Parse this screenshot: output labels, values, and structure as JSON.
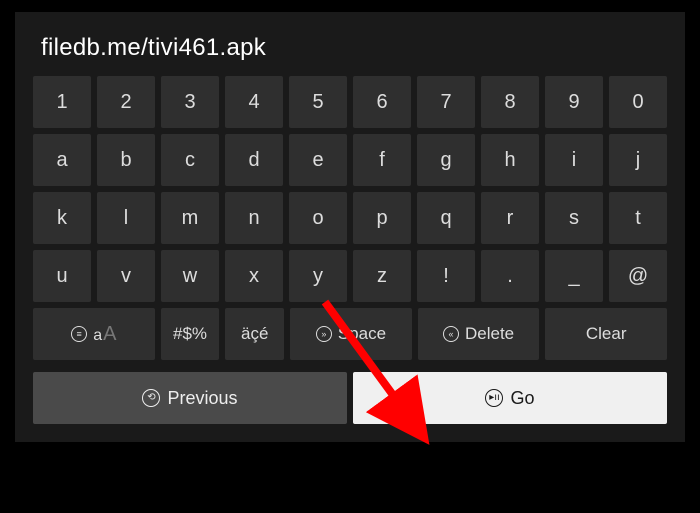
{
  "url_field": {
    "value": "filedb.me/tivi461.apk"
  },
  "keyboard": {
    "row1": [
      "1",
      "2",
      "3",
      "4",
      "5",
      "6",
      "7",
      "8",
      "9",
      "0"
    ],
    "row2": [
      "a",
      "b",
      "c",
      "d",
      "e",
      "f",
      "g",
      "h",
      "i",
      "j"
    ],
    "row3": [
      "k",
      "l",
      "m",
      "n",
      "o",
      "p",
      "q",
      "r",
      "s",
      "t"
    ],
    "row4": [
      "u",
      "v",
      "w",
      "x",
      "y",
      "z",
      "!",
      ".",
      "_",
      "@"
    ]
  },
  "special_keys": {
    "case": {
      "small": "a",
      "big": "A"
    },
    "symbols": "#$%",
    "accents": "äçé",
    "space": "Space",
    "delete": "Delete",
    "clear": "Clear"
  },
  "actions": {
    "previous": "Previous",
    "go": "Go"
  },
  "colors": {
    "dialog_bg": "#1a1a1a",
    "key_bg": "#2f2f2f",
    "prev_bg": "#4a4a4a",
    "go_bg": "#f0f0f0"
  }
}
